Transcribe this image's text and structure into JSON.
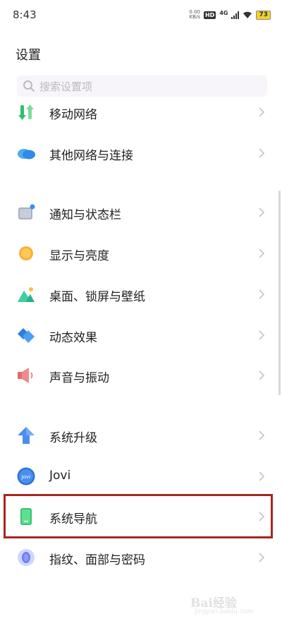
{
  "status_bar": {
    "time": "8:43",
    "net_speed_value": "0.00",
    "net_speed_unit": "KB/s",
    "hd_badge": "HD",
    "network_type": "4G",
    "battery_level": "73",
    "battery_color": "#f5d02a"
  },
  "header": {
    "title": "设置"
  },
  "search": {
    "placeholder": "搜索设置项"
  },
  "settings": {
    "mobile_network": {
      "label": "移动网络",
      "icon": "arrows-updown-icon"
    },
    "other_networks": {
      "label": "其他网络与连接",
      "icon": "cloud-icon"
    },
    "notifications": {
      "label": "通知与状态栏",
      "icon": "notification-icon"
    },
    "display": {
      "label": "显示与亮度",
      "icon": "sun-icon"
    },
    "wallpaper": {
      "label": "桌面、锁屏与壁纸",
      "icon": "landscape-icon"
    },
    "animation": {
      "label": "动态效果",
      "icon": "diamond-icon"
    },
    "sound": {
      "label": "声音与振动",
      "icon": "speaker-icon"
    },
    "system_update": {
      "label": "系统升级",
      "icon": "arrow-up-icon"
    },
    "jovi": {
      "label": "Jovi",
      "icon": "jovi-icon",
      "badge_text": "Jovi"
    },
    "system_navigation": {
      "label": "系统导航",
      "icon": "phone-icon"
    },
    "security": {
      "label": "指纹、面部与密码",
      "icon": "fingerprint-icon"
    }
  },
  "highlight_color": "#a82620",
  "watermark": {
    "text": "Bai经验",
    "sub": "jingyan.baidu.com"
  }
}
